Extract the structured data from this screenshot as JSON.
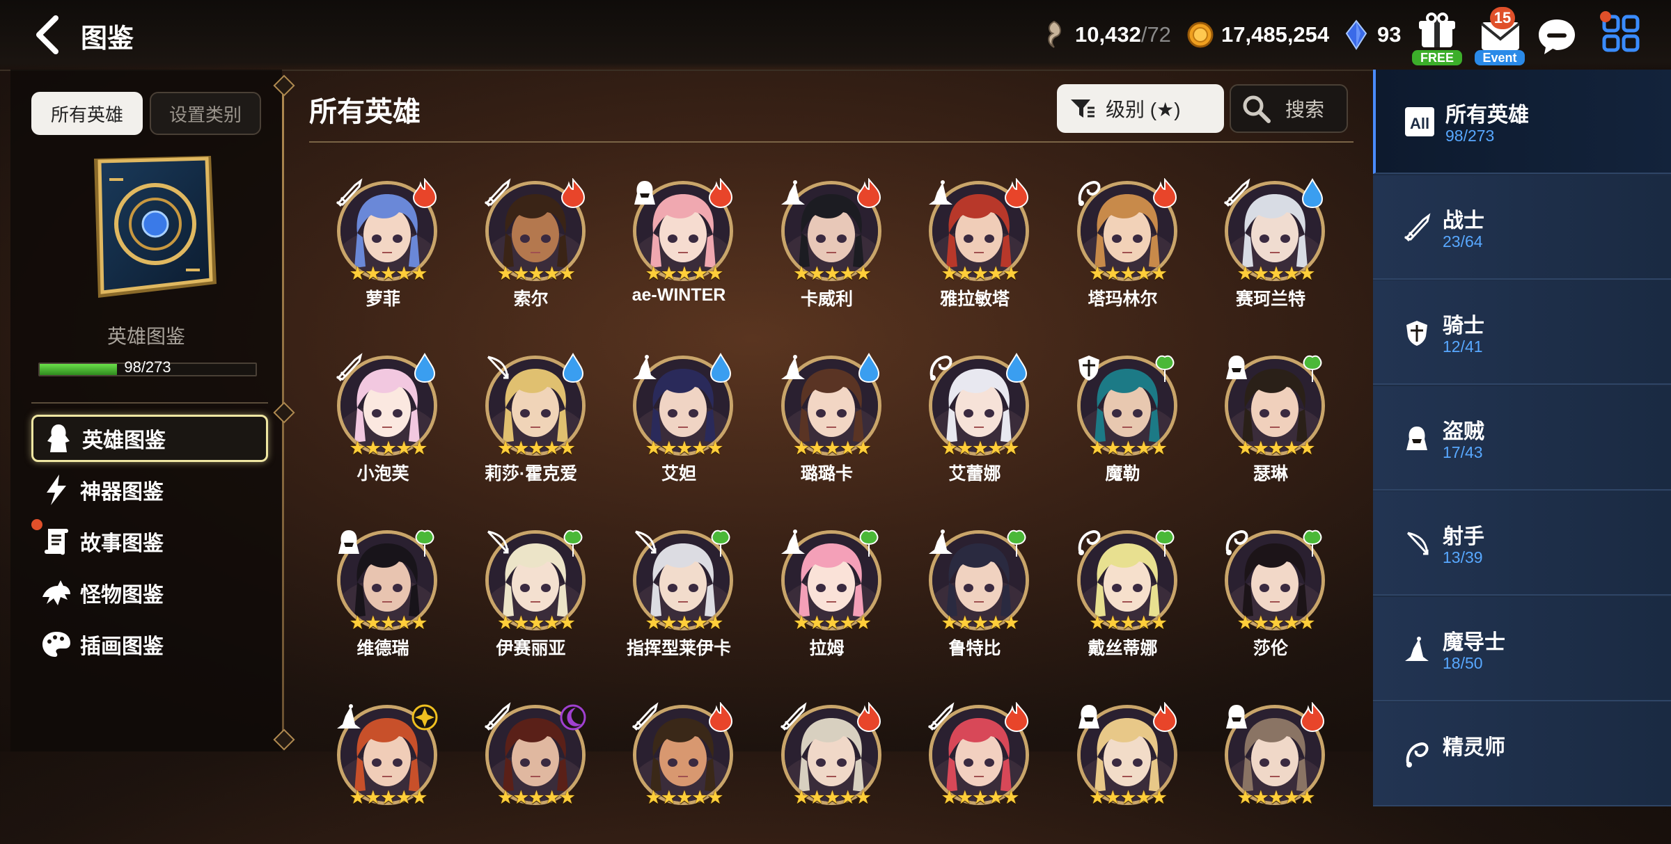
{
  "header": {
    "title": "图鉴",
    "resources": {
      "stamina": {
        "value": "10,432",
        "max": "/72"
      },
      "gold": {
        "value": "17,485,254"
      },
      "crystal": {
        "value": "93"
      }
    },
    "free_label": "FREE",
    "event_label": "Event",
    "event_badge": "15"
  },
  "left": {
    "tabs": [
      "所有英雄",
      "设置类别"
    ],
    "book_label": "英雄图鉴",
    "progress": {
      "text": "98/273",
      "fraction": 0.359
    },
    "nav": [
      {
        "label": "英雄图鉴",
        "active": true
      },
      {
        "label": "神器图鉴",
        "active": false
      },
      {
        "label": "故事图鉴",
        "active": false
      },
      {
        "label": "怪物图鉴",
        "active": false
      },
      {
        "label": "插画图鉴",
        "active": false
      }
    ]
  },
  "main": {
    "title": "所有英雄",
    "sort_label": "级别 (★)",
    "search_label": "搜索",
    "stars": "★★★★★",
    "heroes": [
      {
        "name": "萝菲",
        "cls": "warrior",
        "elem": "fire",
        "hair": "#6a88d8",
        "skin": "#f3d6c4"
      },
      {
        "name": "索尔",
        "cls": "warrior",
        "elem": "fire",
        "hair": "#3a2416",
        "skin": "#b4784e"
      },
      {
        "name": "ae-WINTER",
        "cls": "thief",
        "elem": "fire",
        "hair": "#f0a8b0",
        "skin": "#f6dcd0"
      },
      {
        "name": "卡威利",
        "cls": "mage",
        "elem": "fire",
        "hair": "#1c1c22",
        "skin": "#e8c8b8"
      },
      {
        "name": "雅拉敏塔",
        "cls": "mage",
        "elem": "fire",
        "hair": "#b8382a",
        "skin": "#f0cdb8"
      },
      {
        "name": "塔玛林尔",
        "cls": "spirit",
        "elem": "fire",
        "hair": "#c88a4a",
        "skin": "#f2d2b8"
      },
      {
        "name": "赛珂兰特",
        "cls": "warrior",
        "elem": "water",
        "hair": "#d8dce4",
        "skin": "#f0dcd0"
      },
      {
        "name": "小泡芙",
        "cls": "warrior",
        "elem": "water",
        "hair": "#f2c8e0",
        "skin": "#fbe8e0"
      },
      {
        "name": "莉莎·霍克爱",
        "cls": "archer",
        "elem": "water",
        "hair": "#e0c070",
        "skin": "#f0d4b8"
      },
      {
        "name": "艾妲",
        "cls": "mage",
        "elem": "water",
        "hair": "#2a2a5a",
        "skin": "#f0d4c4"
      },
      {
        "name": "璐璐卡",
        "cls": "mage",
        "elem": "water",
        "hair": "#5a3424",
        "skin": "#f2d6c4"
      },
      {
        "name": "艾蕾娜",
        "cls": "spirit",
        "elem": "water",
        "hair": "#e8e8f0",
        "skin": "#f6e2d8"
      },
      {
        "name": "魔勒",
        "cls": "knight",
        "elem": "earth",
        "hair": "#1c7a86",
        "skin": "#e8c8b0"
      },
      {
        "name": "瑟琳",
        "cls": "thief",
        "elem": "earth",
        "hair": "#2a2018",
        "skin": "#f0d0bc"
      },
      {
        "name": "维德瑞",
        "cls": "thief",
        "elem": "earth",
        "hair": "#18141a",
        "skin": "#e8c4b0"
      },
      {
        "name": "伊赛丽亚",
        "cls": "archer",
        "elem": "earth",
        "hair": "#ece4c8",
        "skin": "#f4e0d0"
      },
      {
        "name": "指挥型莱伊卡",
        "cls": "archer",
        "elem": "earth",
        "hair": "#dcdce2",
        "skin": "#f2dccc"
      },
      {
        "name": "拉姆",
        "cls": "mage",
        "elem": "earth",
        "hair": "#f4a0b8",
        "skin": "#fae2d8"
      },
      {
        "name": "鲁特比",
        "cls": "mage",
        "elem": "earth",
        "hair": "#2a2a40",
        "skin": "#f0d2c0"
      },
      {
        "name": "戴丝蒂娜",
        "cls": "spirit",
        "elem": "earth",
        "hair": "#e8e090",
        "skin": "#f6e0cc"
      },
      {
        "name": "莎伦",
        "cls": "spirit",
        "elem": "earth",
        "hair": "#1c1418",
        "skin": "#f2d8c8"
      },
      {
        "name": "",
        "cls": "mage",
        "elem": "light",
        "hair": "#c8502a",
        "skin": "#f0cdb8"
      },
      {
        "name": "",
        "cls": "warrior",
        "elem": "dark",
        "hair": "#5a2018",
        "skin": "#e0b8a0"
      },
      {
        "name": "",
        "cls": "warrior",
        "elem": "fire",
        "hair": "#3a2818",
        "skin": "#d89870"
      },
      {
        "name": "",
        "cls": "warrior",
        "elem": "fire",
        "hair": "#d8d0c0",
        "skin": "#f0d8c8"
      },
      {
        "name": "",
        "cls": "warrior",
        "elem": "fire",
        "hair": "#d84858",
        "skin": "#f2d0c0"
      },
      {
        "name": "",
        "cls": "thief",
        "elem": "fire",
        "hair": "#e8c888",
        "skin": "#f2dcc8"
      },
      {
        "name": "",
        "cls": "thief",
        "elem": "fire",
        "hair": "#8a7464",
        "skin": "#f0d8c8"
      }
    ]
  },
  "right": {
    "categories": [
      {
        "title": "所有英雄",
        "count": "98/273",
        "icon": "all-icon",
        "active": true
      },
      {
        "title": "战士",
        "count": "23/64",
        "icon": "warrior-icon",
        "active": false
      },
      {
        "title": "骑士",
        "count": "12/41",
        "icon": "knight-icon",
        "active": false
      },
      {
        "title": "盗贼",
        "count": "17/43",
        "icon": "thief-icon",
        "active": false
      },
      {
        "title": "射手",
        "count": "13/39",
        "icon": "archer-icon",
        "active": false
      },
      {
        "title": "魔导士",
        "count": "18/50",
        "icon": "mage-icon",
        "active": false
      },
      {
        "title": "精灵师",
        "count": "",
        "icon": "spirit-icon",
        "active": false
      }
    ]
  },
  "colors": {
    "fire": "#e8452a",
    "water": "#3a9ef0",
    "earth": "#4ab838",
    "light": "#f0c020",
    "dark": "#a040d0",
    "accent_blue": "#58a8ff",
    "gold": "#c9a56a"
  }
}
